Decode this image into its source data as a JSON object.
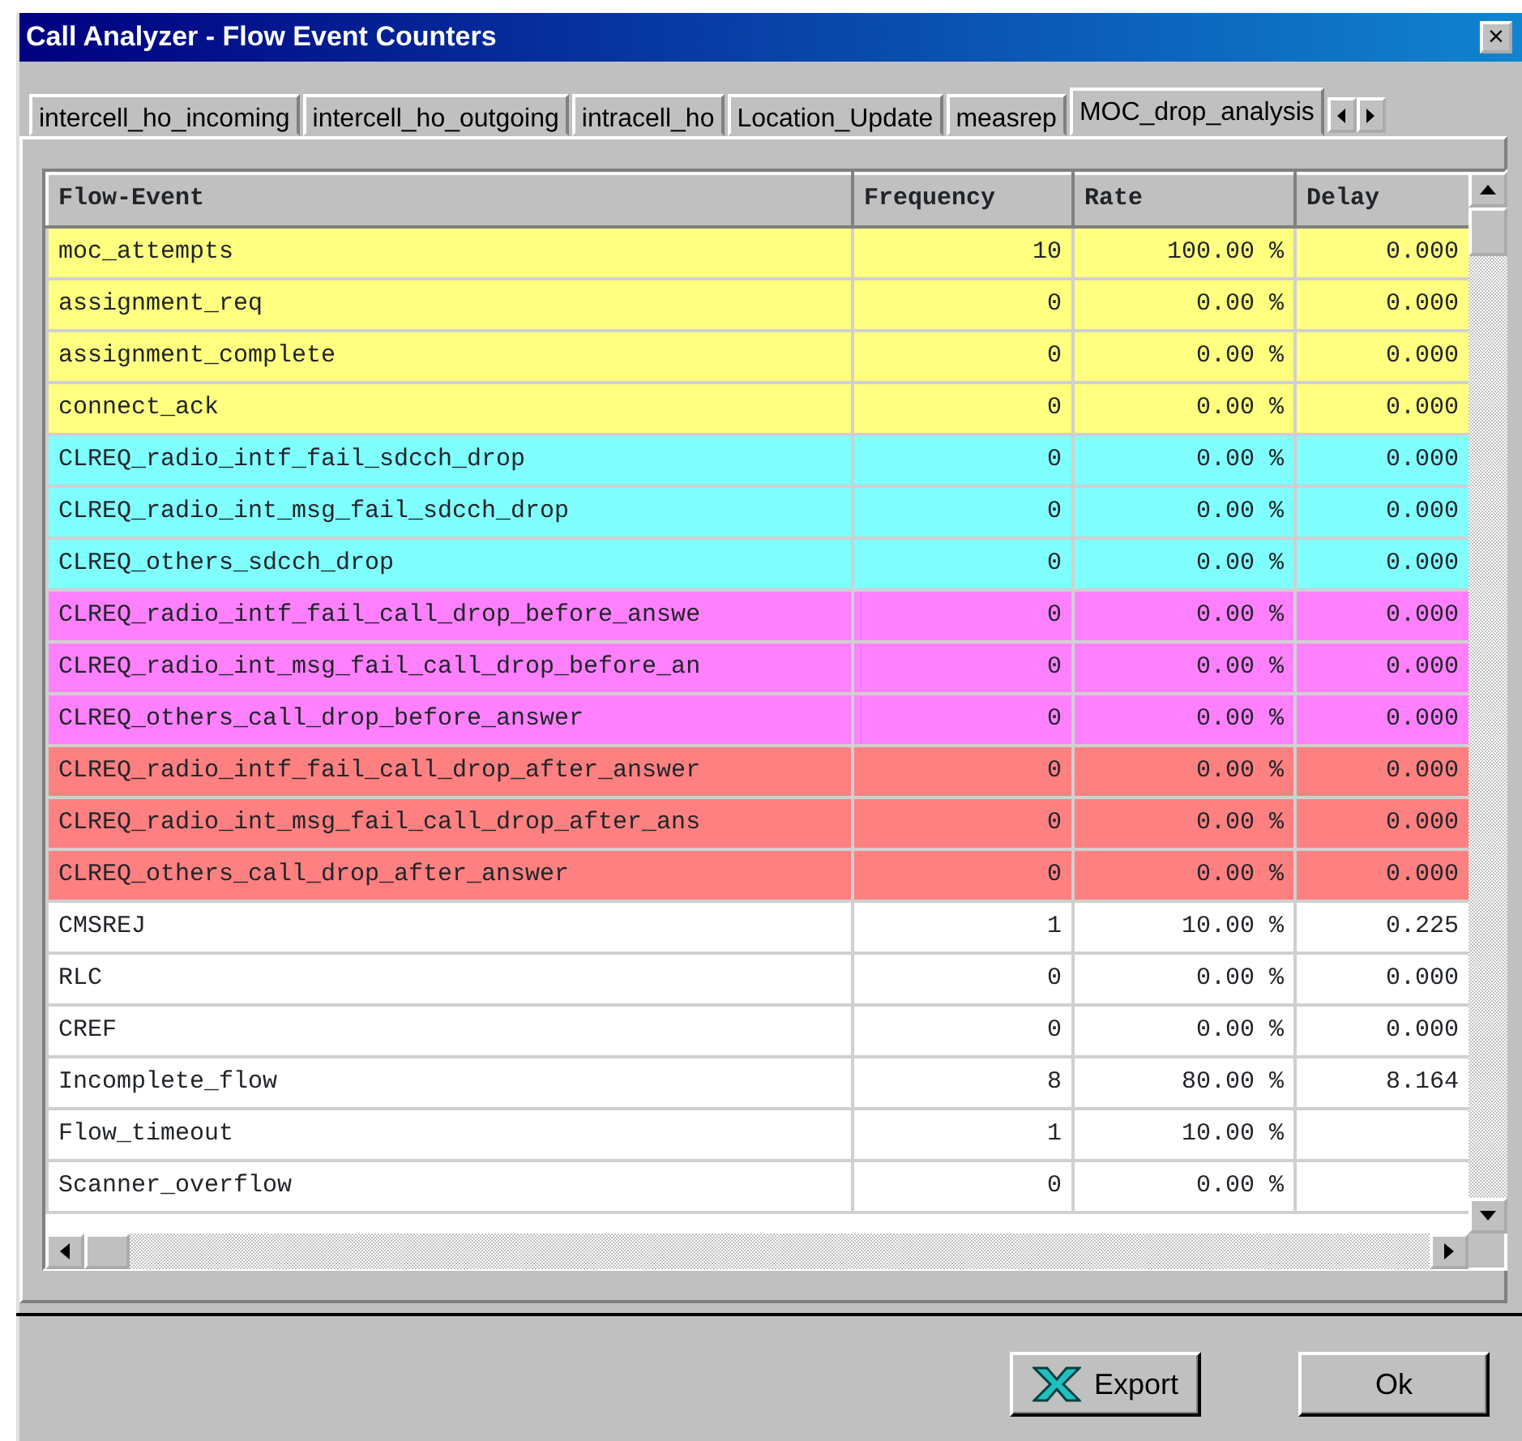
{
  "window": {
    "title": "Call Analyzer - Flow Event Counters",
    "close_label": "×"
  },
  "tabs": [
    {
      "label": "intercell_ho_incoming",
      "selected": false
    },
    {
      "label": "intercell_ho_outgoing",
      "selected": false
    },
    {
      "label": "intracell_ho",
      "selected": false
    },
    {
      "label": "Location_Update",
      "selected": false
    },
    {
      "label": "measrep",
      "selected": false
    },
    {
      "label": "MOC_drop_analysis",
      "selected": true
    }
  ],
  "table": {
    "columns": [
      "Flow-Event",
      "Frequency",
      "Rate",
      "Delay"
    ],
    "rows": [
      {
        "cells": [
          "moc_attempts",
          "10",
          "100.00 %",
          "0.000"
        ],
        "color": "#ffff80"
      },
      {
        "cells": [
          "assignment_req",
          "0",
          "0.00 %",
          "0.000"
        ],
        "color": "#ffff80"
      },
      {
        "cells": [
          "assignment_complete",
          "0",
          "0.00 %",
          "0.000"
        ],
        "color": "#ffff80"
      },
      {
        "cells": [
          "connect_ack",
          "0",
          "0.00 %",
          "0.000"
        ],
        "color": "#ffff80"
      },
      {
        "cells": [
          "CLREQ_radio_intf_fail_sdcch_drop",
          "0",
          "0.00 %",
          "0.000"
        ],
        "color": "#80ffff"
      },
      {
        "cells": [
          "CLREQ_radio_int_msg_fail_sdcch_drop",
          "0",
          "0.00 %",
          "0.000"
        ],
        "color": "#80ffff"
      },
      {
        "cells": [
          "CLREQ_others_sdcch_drop",
          "0",
          "0.00 %",
          "0.000"
        ],
        "color": "#80ffff"
      },
      {
        "cells": [
          "CLREQ_radio_intf_fail_call_drop_before_answe",
          "0",
          "0.00 %",
          "0.000"
        ],
        "color": "#ff80ff"
      },
      {
        "cells": [
          "CLREQ_radio_int_msg_fail_call_drop_before_an",
          "0",
          "0.00 %",
          "0.000"
        ],
        "color": "#ff80ff"
      },
      {
        "cells": [
          "CLREQ_others_call_drop_before_answer",
          "0",
          "0.00 %",
          "0.000"
        ],
        "color": "#ff80ff"
      },
      {
        "cells": [
          "CLREQ_radio_intf_fail_call_drop_after_answer",
          "0",
          "0.00 %",
          "0.000"
        ],
        "color": "#ff8080"
      },
      {
        "cells": [
          "CLREQ_radio_int_msg_fail_call_drop_after_ans",
          "0",
          "0.00 %",
          "0.000"
        ],
        "color": "#ff8080"
      },
      {
        "cells": [
          "CLREQ_others_call_drop_after_answer",
          "0",
          "0.00 %",
          "0.000"
        ],
        "color": "#ff8080"
      },
      {
        "cells": [
          "CMSREJ",
          "1",
          "10.00 %",
          "0.225"
        ],
        "color": "#ffffff"
      },
      {
        "cells": [
          "RLC",
          "0",
          "0.00 %",
          "0.000"
        ],
        "color": "#ffffff"
      },
      {
        "cells": [
          "CREF",
          "0",
          "0.00 %",
          "0.000"
        ],
        "color": "#ffffff"
      },
      {
        "cells": [
          "Incomplete_flow",
          "8",
          "80.00 %",
          "8.164"
        ],
        "color": "#ffffff"
      },
      {
        "cells": [
          "Flow_timeout",
          "1",
          "10.00 %",
          ""
        ],
        "color": "#ffffff"
      },
      {
        "cells": [
          "Scanner_overflow",
          "0",
          "0.00 %",
          ""
        ],
        "color": "#ffffff"
      }
    ]
  },
  "buttons": [
    {
      "label": "Export",
      "kind": "export"
    },
    {
      "label": "Ok",
      "kind": "plain"
    }
  ]
}
